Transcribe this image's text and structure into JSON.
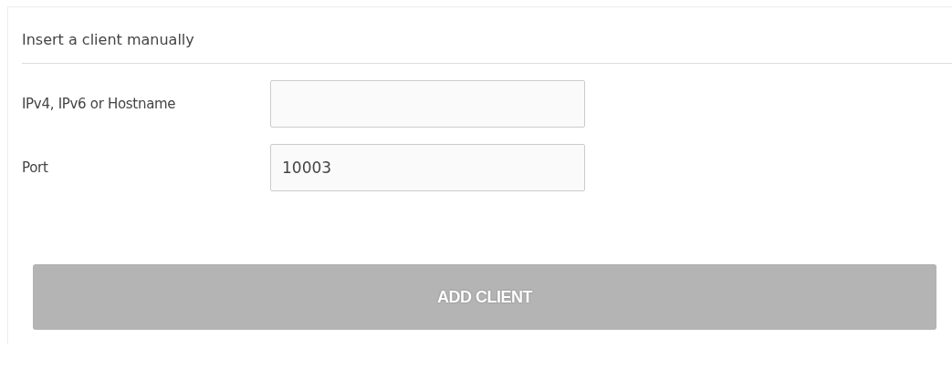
{
  "panel": {
    "title": "Insert a client manually"
  },
  "fields": [
    {
      "label": "IPv4, IPv6 or Hostname"
    },
    {
      "label": "Port",
      "value": "10003"
    }
  ],
  "button": {
    "label": "ADD CLIENT",
    "disabled": true
  }
}
